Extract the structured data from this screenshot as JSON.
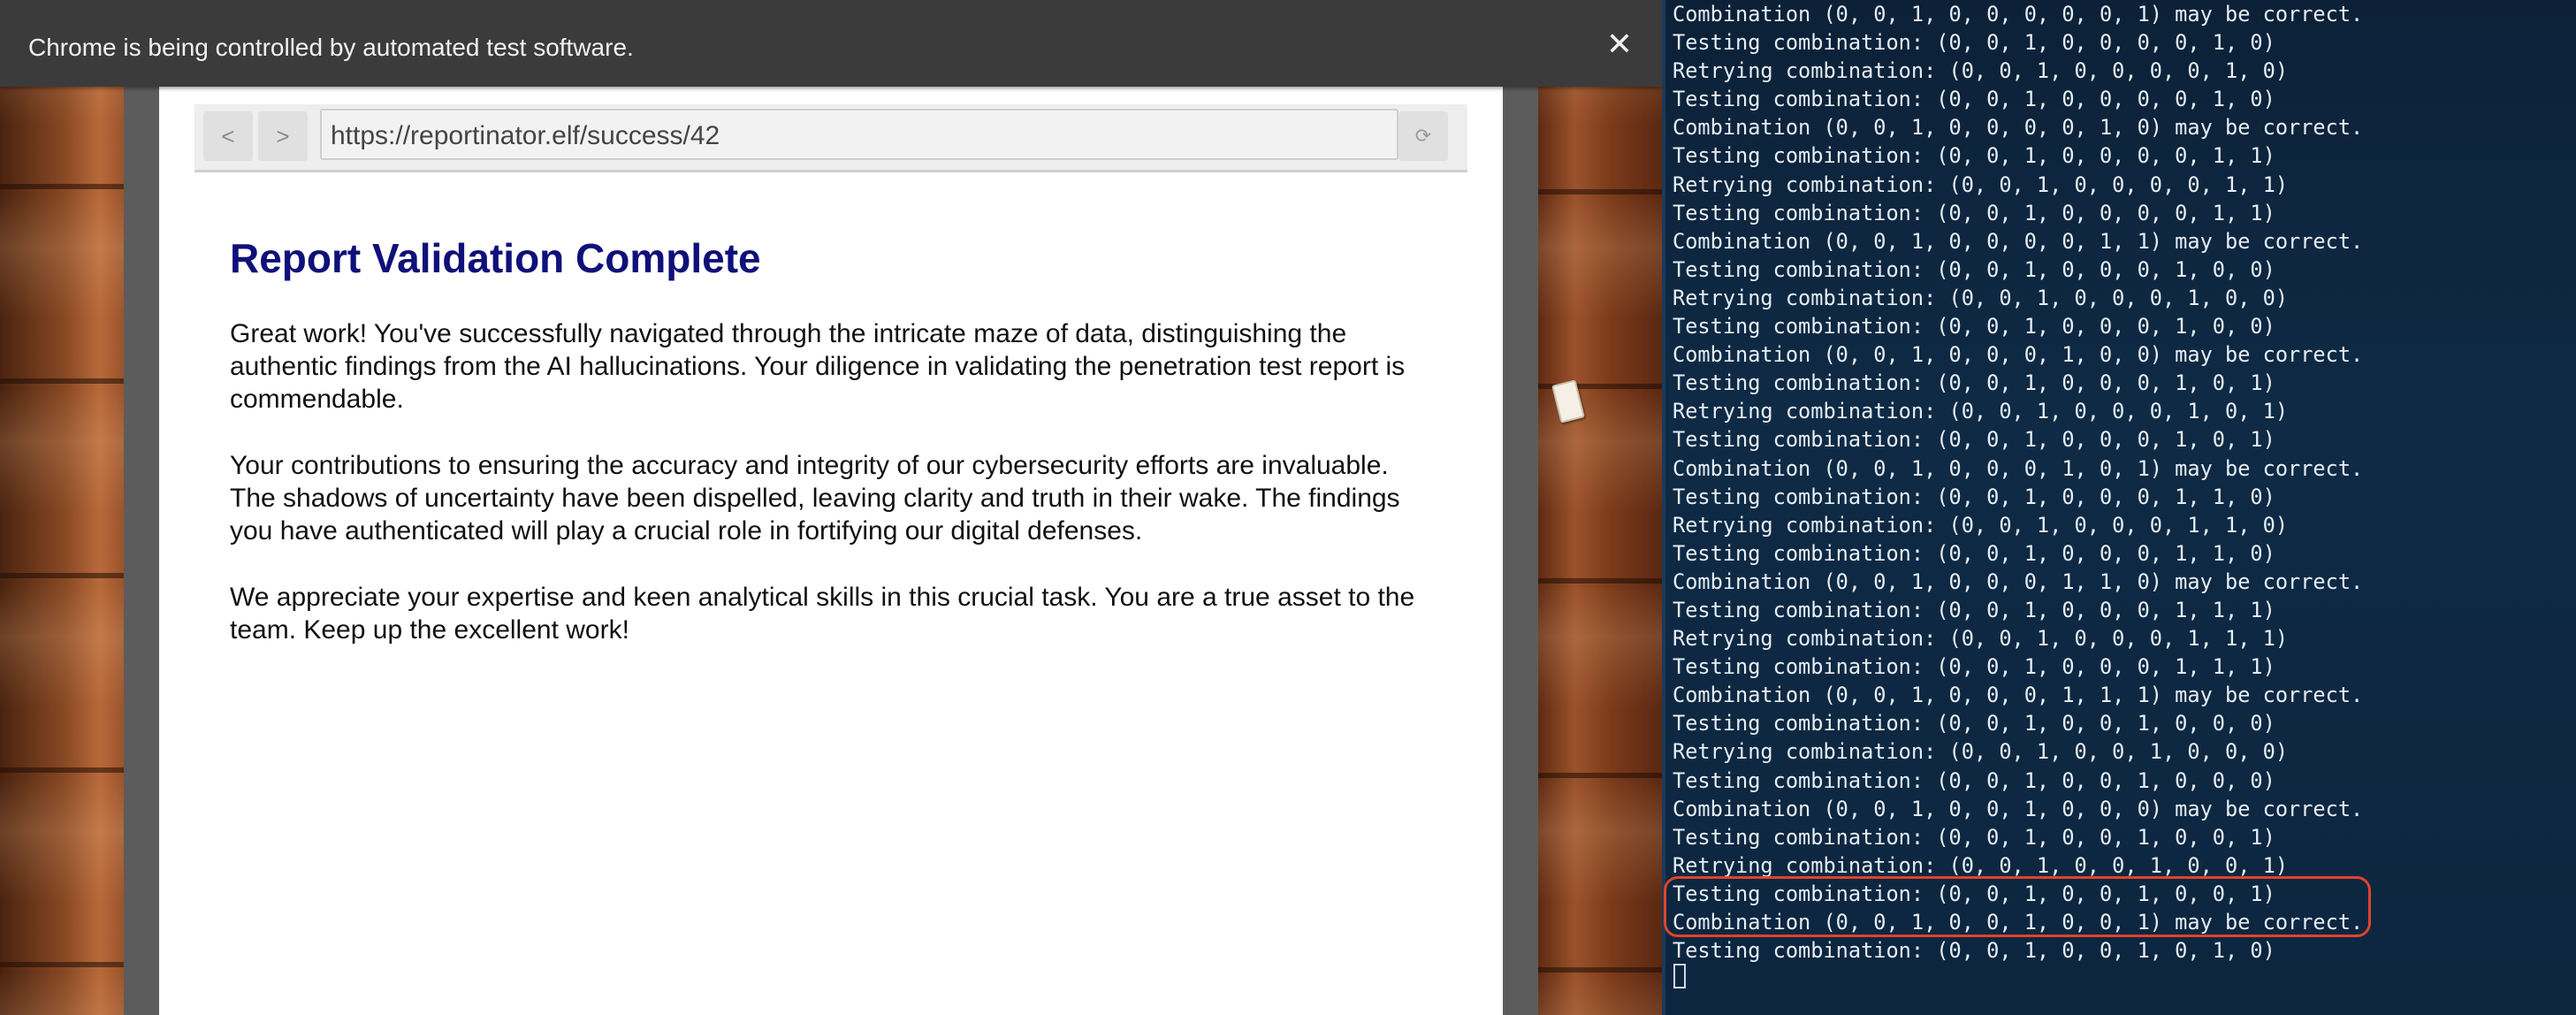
{
  "infobar": {
    "message": "Chrome is being controlled by automated test software.",
    "close_icon": "close-icon"
  },
  "browser": {
    "back_label": "<",
    "forward_label": ">",
    "url": "https://reportinator.elf/success/42",
    "reload_label": "⟳"
  },
  "page": {
    "title": "Report Validation Complete",
    "paragraphs": [
      "Great work! You've successfully navigated through the intricate maze of data, distinguishing the authentic findings from the AI hallucinations. Your diligence in validating the penetration test report is commendable.",
      "Your contributions to ensuring the accuracy and integrity of our cybersecurity efforts are invaluable. The shadows of uncertainty have been dispelled, leaving clarity and truth in their wake. The findings you have authenticated will play a crucial role in fortifying our digital defenses.",
      "We appreciate your expertise and keen analytical skills in this crucial task. You are a true asset to the team. Keep up the excellent work!"
    ]
  },
  "terminal": {
    "lines": [
      "Combination (0, 0, 1, 0, 0, 0, 0, 0, 1) may be correct.",
      "Testing combination: (0, 0, 1, 0, 0, 0, 0, 1, 0)",
      "Retrying combination: (0, 0, 1, 0, 0, 0, 0, 1, 0)",
      "Testing combination: (0, 0, 1, 0, 0, 0, 0, 1, 0)",
      "Combination (0, 0, 1, 0, 0, 0, 0, 1, 0) may be correct.",
      "Testing combination: (0, 0, 1, 0, 0, 0, 0, 1, 1)",
      "Retrying combination: (0, 0, 1, 0, 0, 0, 0, 1, 1)",
      "Testing combination: (0, 0, 1, 0, 0, 0, 0, 1, 1)",
      "Combination (0, 0, 1, 0, 0, 0, 0, 1, 1) may be correct.",
      "Testing combination: (0, 0, 1, 0, 0, 0, 1, 0, 0)",
      "Retrying combination: (0, 0, 1, 0, 0, 0, 1, 0, 0)",
      "Testing combination: (0, 0, 1, 0, 0, 0, 1, 0, 0)",
      "Combination (0, 0, 1, 0, 0, 0, 1, 0, 0) may be correct.",
      "Testing combination: (0, 0, 1, 0, 0, 0, 1, 0, 1)",
      "Retrying combination: (0, 0, 1, 0, 0, 0, 1, 0, 1)",
      "Testing combination: (0, 0, 1, 0, 0, 0, 1, 0, 1)",
      "Combination (0, 0, 1, 0, 0, 0, 1, 0, 1) may be correct.",
      "Testing combination: (0, 0, 1, 0, 0, 0, 1, 1, 0)",
      "Retrying combination: (0, 0, 1, 0, 0, 0, 1, 1, 0)",
      "Testing combination: (0, 0, 1, 0, 0, 0, 1, 1, 0)",
      "Combination (0, 0, 1, 0, 0, 0, 1, 1, 0) may be correct.",
      "Testing combination: (0, 0, 1, 0, 0, 0, 1, 1, 1)",
      "Retrying combination: (0, 0, 1, 0, 0, 0, 1, 1, 1)",
      "Testing combination: (0, 0, 1, 0, 0, 0, 1, 1, 1)",
      "Combination (0, 0, 1, 0, 0, 0, 1, 1, 1) may be correct.",
      "Testing combination: (0, 0, 1, 0, 0, 1, 0, 0, 0)",
      "Retrying combination: (0, 0, 1, 0, 0, 1, 0, 0, 0)",
      "Testing combination: (0, 0, 1, 0, 0, 1, 0, 0, 0)",
      "Combination (0, 0, 1, 0, 0, 1, 0, 0, 0) may be correct.",
      "Testing combination: (0, 0, 1, 0, 0, 1, 0, 0, 1)",
      "Retrying combination: (0, 0, 1, 0, 0, 1, 0, 0, 1)",
      "Testing combination: (0, 0, 1, 0, 0, 1, 0, 0, 1)",
      "Combination (0, 0, 1, 0, 0, 1, 0, 0, 1) may be correct.",
      "Testing combination: (0, 0, 1, 0, 0, 1, 0, 1, 0)"
    ],
    "highlight_color": "#e0432a",
    "background_color": "#0f2a45"
  }
}
